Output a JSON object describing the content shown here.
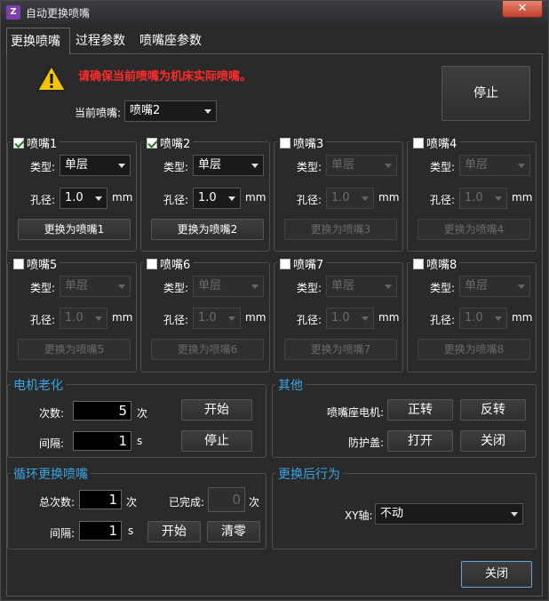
{
  "window": {
    "title": "自动更换喷嘴",
    "close_glyph": "✕",
    "app_icon_glyph": "Z"
  },
  "tabs": [
    {
      "label": "更换喷嘴"
    },
    {
      "label": "过程参数"
    },
    {
      "label": "喷嘴座参数"
    }
  ],
  "warning_text": "请确保当前喷嘴为机床实际喷嘴。",
  "stop_button": "停止",
  "current_nozzle": {
    "label": "当前喷嘴:",
    "value": "喷嘴2"
  },
  "nozzles": [
    {
      "name": "喷嘴1",
      "checked": true,
      "type_label": "类型:",
      "type": "单层",
      "hole_label": "孔径:",
      "hole": "1.0",
      "unit": "mm",
      "button": "更换为喷嘴1"
    },
    {
      "name": "喷嘴2",
      "checked": true,
      "type_label": "类型:",
      "type": "单层",
      "hole_label": "孔径:",
      "hole": "1.0",
      "unit": "mm",
      "button": "更换为喷嘴2"
    },
    {
      "name": "喷嘴3",
      "checked": false,
      "type_label": "类型:",
      "type": "单层",
      "hole_label": "孔径:",
      "hole": "1.0",
      "unit": "mm",
      "button": "更换为喷嘴3"
    },
    {
      "name": "喷嘴4",
      "checked": false,
      "type_label": "类型:",
      "type": "单层",
      "hole_label": "孔径:",
      "hole": "1.0",
      "unit": "mm",
      "button": "更换为喷嘴4"
    },
    {
      "name": "喷嘴5",
      "checked": false,
      "type_label": "类型:",
      "type": "单层",
      "hole_label": "孔径:",
      "hole": "1.0",
      "unit": "mm",
      "button": "更换为喷嘴5"
    },
    {
      "name": "喷嘴6",
      "checked": false,
      "type_label": "类型:",
      "type": "单层",
      "hole_label": "孔径:",
      "hole": "1.0",
      "unit": "mm",
      "button": "更换为喷嘴6"
    },
    {
      "name": "喷嘴7",
      "checked": false,
      "type_label": "类型:",
      "type": "单层",
      "hole_label": "孔径:",
      "hole": "1.0",
      "unit": "mm",
      "button": "更换为喷嘴7"
    },
    {
      "name": "喷嘴8",
      "checked": false,
      "type_label": "类型:",
      "type": "单层",
      "hole_label": "孔径:",
      "hole": "1.0",
      "unit": "mm",
      "button": "更换为喷嘴8"
    }
  ],
  "motor_aging": {
    "title": "电机老化",
    "count_label": "次数:",
    "count": "5",
    "count_unit": "次",
    "interval_label": "间隔:",
    "interval": "1",
    "interval_unit": "s",
    "start": "开始",
    "stop": "停止"
  },
  "other": {
    "title": "其他",
    "motor_label": "喷嘴座电机:",
    "forward": "正转",
    "reverse": "反转",
    "cover_label": "防护盖:",
    "open": "打开",
    "close": "关闭"
  },
  "cycle": {
    "title": "循环更换喷嘴",
    "total_label": "总次数:",
    "total": "1",
    "total_unit": "次",
    "done_label": "已完成:",
    "done": "0",
    "done_unit": "次",
    "interval_label": "间隔:",
    "interval": "1",
    "interval_unit": "s",
    "start": "开始",
    "clear": "清零"
  },
  "after": {
    "title": "更换后行为",
    "xy_label": "XY轴:",
    "xy_value": "不动"
  },
  "close_button": "关闭",
  "colors": {
    "warning_red": "#ff2a2a",
    "group_title_blue": "#3aa3e3",
    "background": "#2a2a2a"
  }
}
